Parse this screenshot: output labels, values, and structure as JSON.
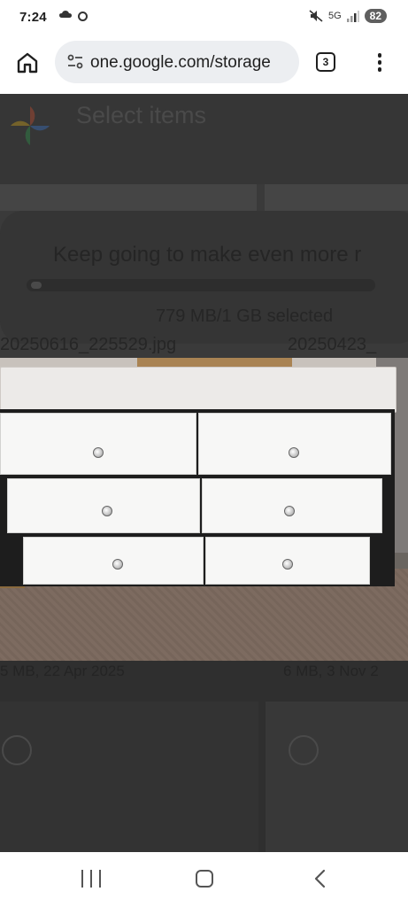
{
  "status_bar": {
    "time": "7:24",
    "network": "5G",
    "battery": "82"
  },
  "browser": {
    "url": "one.google.com/storage",
    "tab_count": "3"
  },
  "background_page": {
    "title": "Select items",
    "message": "Keep going to make even more r",
    "progress_fraction": 0.03,
    "selected_size": "779 MB/1 GB selected",
    "file_left": "20250616_225529.jpg",
    "file_right": "20250423_",
    "size_left": "5 MB, 22 Apr 2025",
    "size_right": "6 MB, 3 Nov 2"
  },
  "icons": {
    "home": "home-icon",
    "tune": "tune-icon",
    "menu": "more-vert-icon",
    "photos": "google-photos-logo",
    "nav_recent": "recent-apps-icon",
    "nav_home": "nav-home-icon",
    "nav_back": "back-icon"
  }
}
